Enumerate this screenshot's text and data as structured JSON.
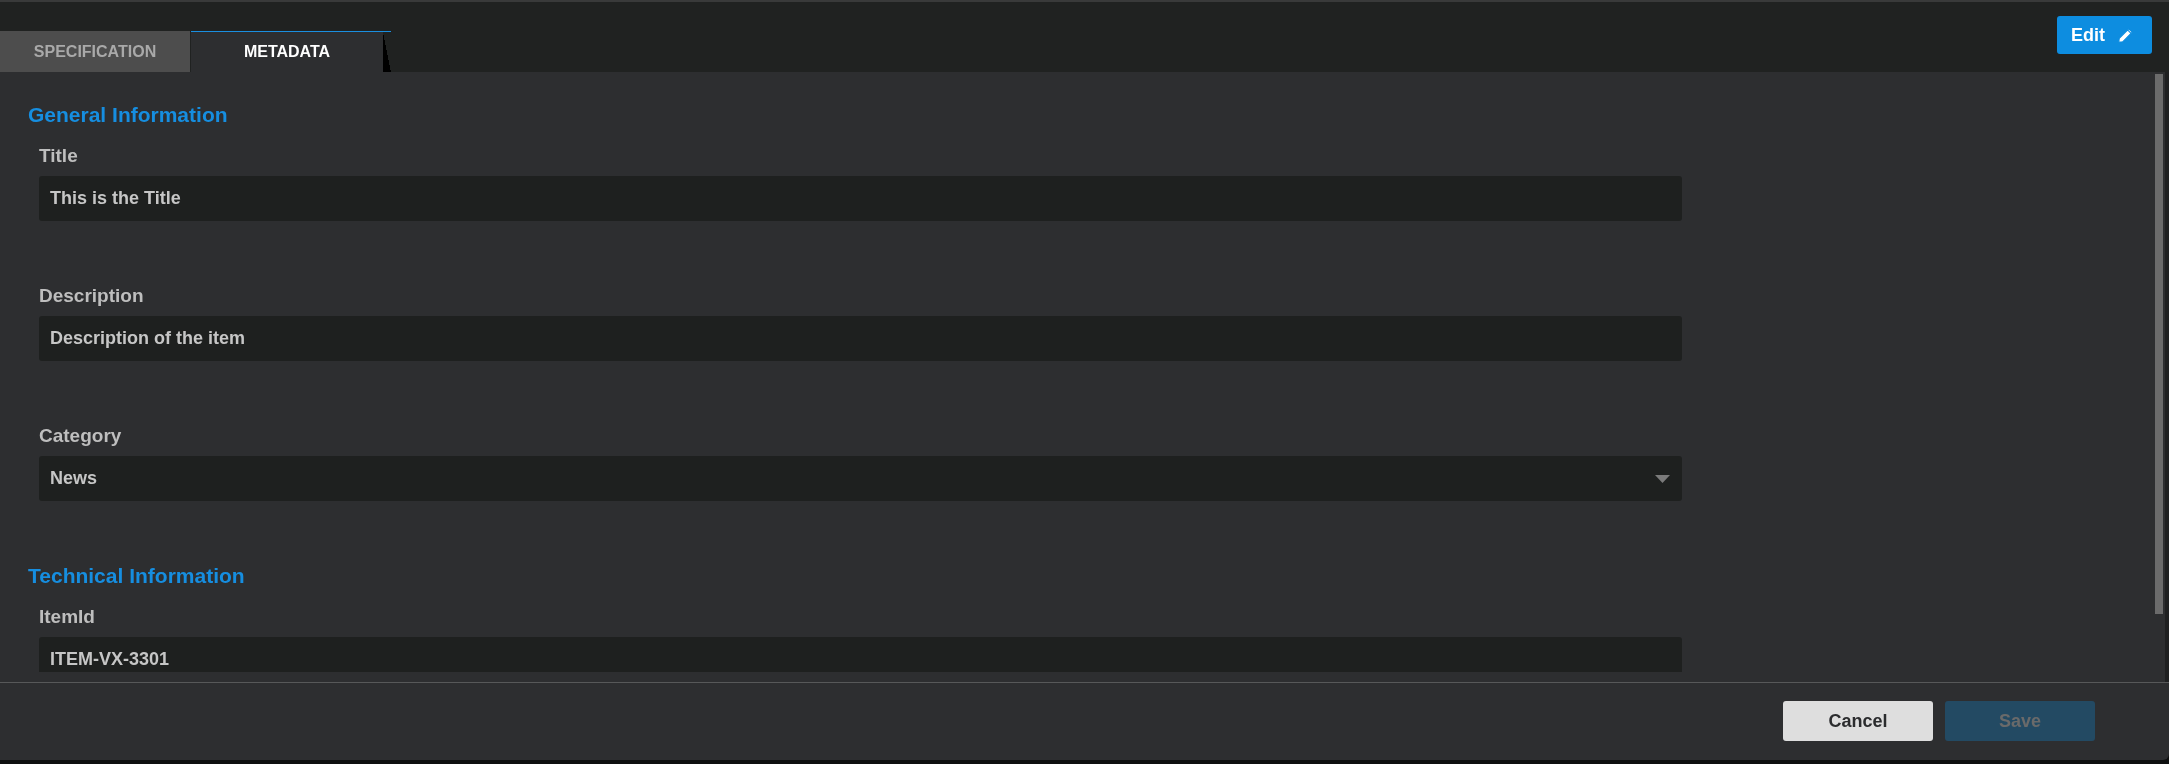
{
  "tabs": [
    {
      "label": "SPECIFICATION",
      "selected": false
    },
    {
      "label": "METADATA",
      "selected": true
    }
  ],
  "edit_button": {
    "label": "Edit"
  },
  "sections": [
    {
      "title": "General Information",
      "fields": [
        {
          "kind": "text",
          "label": "Title",
          "value": "This is the Title"
        },
        {
          "kind": "text",
          "label": "Description",
          "value": "Description of the item"
        },
        {
          "kind": "select",
          "label": "Category",
          "value": "News"
        }
      ]
    },
    {
      "title": "Technical Information",
      "fields": [
        {
          "kind": "text",
          "label": "ItemId",
          "value": "ITEM-VX-3301"
        }
      ]
    }
  ],
  "footer": {
    "buttons": [
      {
        "label": "Cancel",
        "disabled": false
      },
      {
        "label": "Save",
        "disabled": true
      }
    ]
  }
}
